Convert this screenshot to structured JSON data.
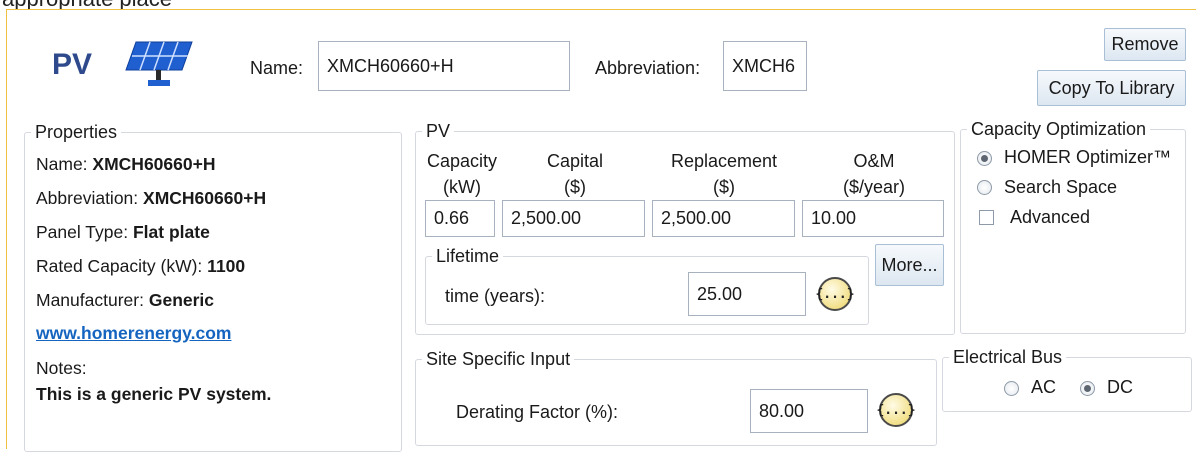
{
  "top_cut_text": "appropriate place",
  "header": {
    "component_label": "PV",
    "name_label": "Name:",
    "name_value": "XMCH60660+H",
    "abbreviation_label": "Abbreviation:",
    "abbreviation_value": "XMCH6",
    "remove_label": "Remove",
    "copy_label": "Copy To Library"
  },
  "properties": {
    "legend": "Properties",
    "name_label": "Name:",
    "name_value": "XMCH60660+H",
    "abbreviation_label": "Abbreviation:",
    "abbreviation_value": "XMCH60660+H",
    "panel_type_label": "Panel Type:",
    "panel_type_value": "Flat plate",
    "rated_label": "Rated Capacity (kW):",
    "rated_value": "1100",
    "manufacturer_label": "Manufacturer:",
    "manufacturer_value": "Generic",
    "website": "www.homerenergy.com",
    "notes_label": "Notes:",
    "notes_value": "This is a generic PV system."
  },
  "pv": {
    "legend": "PV",
    "capacity_h1": "Capacity",
    "capacity_h2": "(kW)",
    "capital_h1": "Capital",
    "capital_h2": "($)",
    "replacement_h1": "Replacement",
    "replacement_h2": "($)",
    "om_h1": "O&M",
    "om_h2": "($/year)",
    "capacity_value": "0.66",
    "capital_value": "2,500.00",
    "replacement_value": "2,500.00",
    "om_value": "10.00",
    "lifetime_legend": "Lifetime",
    "lifetime_label": "time (years):",
    "lifetime_value": "25.00",
    "curly_icon_text": "{...}",
    "more_label": "More..."
  },
  "capacity_optimization": {
    "legend": "Capacity Optimization",
    "option1": "HOMER Optimizer™",
    "option2": "Search Space",
    "advanced_label": "Advanced",
    "selected": "HOMER Optimizer™",
    "advanced_checked": false
  },
  "site_specific": {
    "legend": "Site Specific Input",
    "derating_label": "Derating Factor (%):",
    "derating_value": "80.00",
    "curly_icon_text": "{...}"
  },
  "electrical_bus": {
    "legend": "Electrical Bus",
    "option_ac": "AC",
    "option_dc": "DC",
    "selected": "DC"
  },
  "colors": {
    "frame_border": "#f0c040",
    "pv_title": "#2e4a8c",
    "link": "#1565c0",
    "button_border": "#a9bfd6"
  }
}
